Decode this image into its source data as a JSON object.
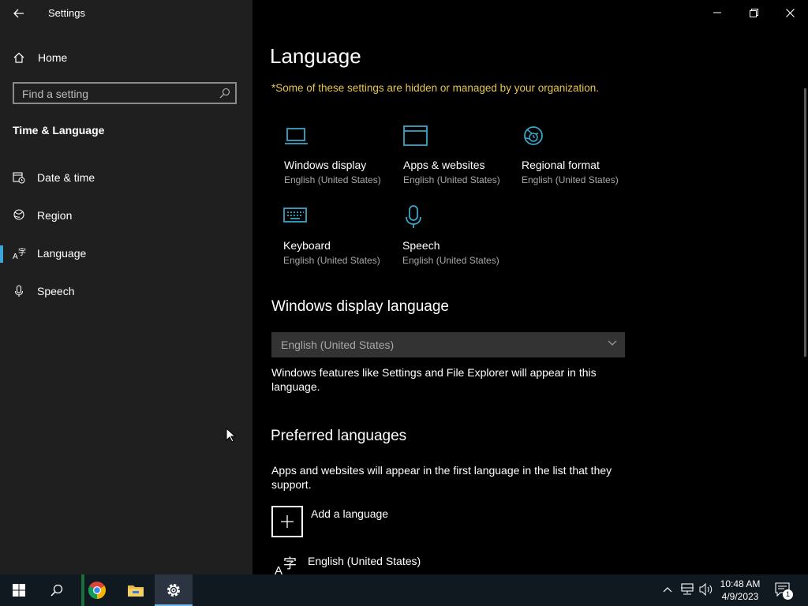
{
  "window": {
    "title": "Settings",
    "back_icon": "back-arrow-icon",
    "minimize_icon": "minimize-icon",
    "restore_icon": "restore-icon",
    "close_icon": "close-icon"
  },
  "sidebar": {
    "home_label": "Home",
    "search": {
      "placeholder": "Find a setting",
      "icon": "search-icon"
    },
    "section_title": "Time & Language",
    "items": [
      {
        "label": "Date & time",
        "icon": "date-time-icon",
        "selected": false
      },
      {
        "label": "Region",
        "icon": "region-globe-icon",
        "selected": false
      },
      {
        "label": "Language",
        "icon": "language-icon",
        "selected": true
      },
      {
        "label": "Speech",
        "icon": "microphone-icon",
        "selected": false
      }
    ]
  },
  "main": {
    "title": "Language",
    "org_note": "*Some of these settings are hidden or managed by your organization.",
    "tiles": [
      {
        "name": "Windows display",
        "value": "English (United States)",
        "icon": "laptop-icon"
      },
      {
        "name": "Apps & websites",
        "value": "English (United States)",
        "icon": "browser-window-icon"
      },
      {
        "name": "Regional format",
        "value": "English (United States)",
        "icon": "regional-format-icon"
      },
      {
        "name": "Keyboard",
        "value": "English (United States)",
        "icon": "keyboard-icon"
      },
      {
        "name": "Speech",
        "value": "English (United States)",
        "icon": "microphone-icon"
      }
    ],
    "display_language": {
      "heading": "Windows display language",
      "selected": "English (United States)",
      "description": "Windows features like Settings and File Explorer will appear in this language."
    },
    "preferred": {
      "heading": "Preferred languages",
      "description": "Apps and websites will appear in the first language in the list that they support.",
      "add_label": "Add a language",
      "languages": [
        {
          "label": "English (United States)",
          "icon": "language-icon"
        }
      ]
    }
  },
  "taskbar": {
    "apps": [
      {
        "name": "start",
        "icon": "windows-start-icon",
        "active": false
      },
      {
        "name": "search",
        "icon": "search-icon",
        "active": false
      },
      {
        "name": "chrome",
        "icon": "chrome-icon",
        "active": false
      },
      {
        "name": "file-explorer",
        "icon": "folder-icon",
        "active": false
      },
      {
        "name": "settings",
        "icon": "gear-icon",
        "active": true
      }
    ],
    "tray": {
      "icons": [
        "chevron-up-icon",
        "network-icon",
        "volume-icon"
      ],
      "time": "10:48 AM",
      "date": "4/9/2023",
      "notification_count": "1"
    }
  },
  "colors": {
    "sidebar_bg": "#1f1f1f",
    "main_bg": "#000000",
    "accent": "#3aa6dc",
    "icon_teal": "#3aa6c8",
    "warning_text": "#e6c64a",
    "taskbar_bg": "#101820"
  }
}
